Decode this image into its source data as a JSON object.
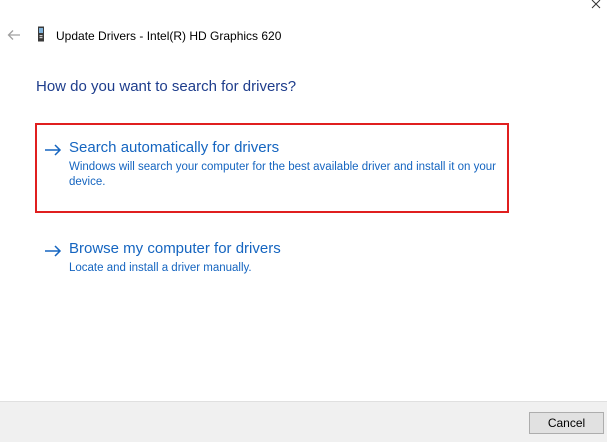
{
  "window": {
    "title": "Update Drivers - Intel(R) HD Graphics 620"
  },
  "main": {
    "heading": "How do you want to search for drivers?",
    "options": [
      {
        "title": "Search automatically for drivers",
        "description": "Windows will search your computer for the best available driver and install it on your device.",
        "highlighted": true
      },
      {
        "title": "Browse my computer for drivers",
        "description": "Locate and install a driver manually.",
        "highlighted": false
      }
    ]
  },
  "footer": {
    "cancel_label": "Cancel"
  },
  "colors": {
    "heading": "#1e3d8c",
    "link": "#1565c0",
    "highlight_border": "#e01f1f",
    "footer_bg": "#f0f0f0"
  },
  "icons": {
    "back": "back-arrow-icon",
    "device": "device-icon",
    "option_arrow": "right-arrow-icon"
  }
}
